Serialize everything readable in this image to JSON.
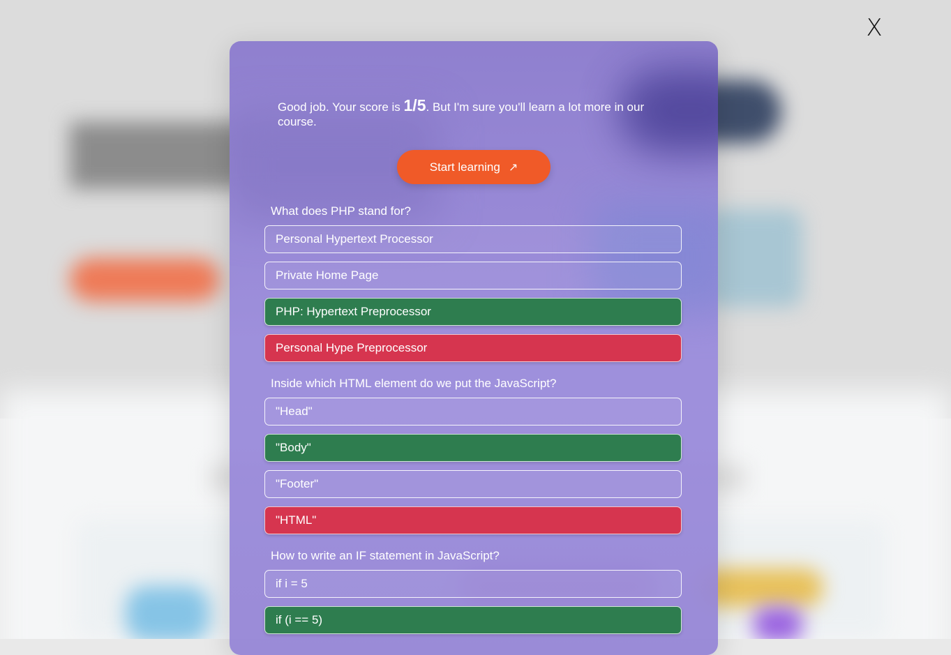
{
  "close_label": "X",
  "result": {
    "prefix": "Good job. Your score is ",
    "score": "1/5",
    "suffix": ". But I'm sure you'll learn a lot more in our course."
  },
  "cta": {
    "label": "Start learning",
    "arrow": "↗"
  },
  "questions": [
    {
      "text": "What does PHP stand for?",
      "options": [
        {
          "label": "Personal Hypertext Processor",
          "state": "neutral"
        },
        {
          "label": "Private Home Page",
          "state": "neutral"
        },
        {
          "label": "PHP: Hypertext Preprocessor",
          "state": "correct"
        },
        {
          "label": "Personal Hype Preprocessor",
          "state": "wrong"
        }
      ]
    },
    {
      "text": "Inside which HTML element do we put the JavaScript?",
      "options": [
        {
          "label": "\"Head\"",
          "state": "neutral"
        },
        {
          "label": "\"Body\"",
          "state": "correct"
        },
        {
          "label": "\"Footer\"",
          "state": "neutral"
        },
        {
          "label": "\"HTML\"",
          "state": "wrong"
        }
      ]
    },
    {
      "text": "How to write an IF statement in JavaScript?",
      "options": [
        {
          "label": "if i = 5",
          "state": "neutral"
        },
        {
          "label": "if (i == 5)",
          "state": "correct"
        }
      ]
    }
  ],
  "colors": {
    "cta": "#f05a28",
    "correct": "#2e7d4f",
    "wrong": "#d6354f",
    "modal": "#9585d4"
  }
}
